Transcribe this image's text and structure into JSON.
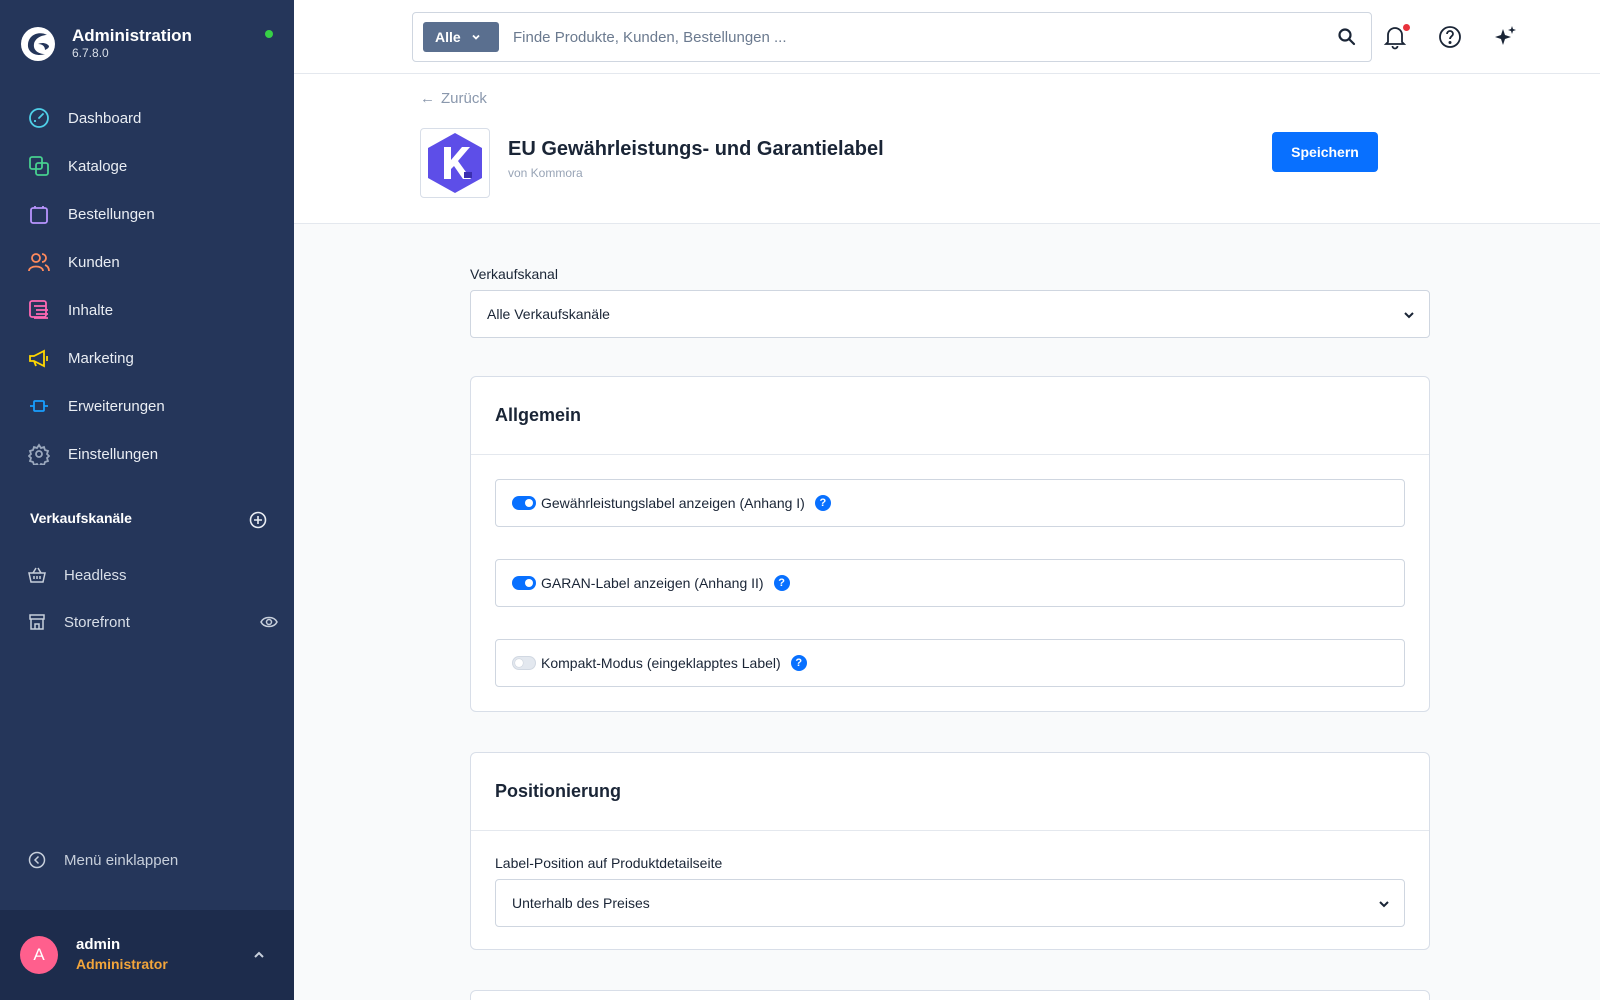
{
  "app": {
    "title": "Administration",
    "version": "6.7.8.0",
    "status_color": "#37d046",
    "accent_color": "#0870ff",
    "sidebar_color": "#25365a"
  },
  "sidebar": {
    "items": [
      {
        "label": "Dashboard",
        "icon": "dashboard-gauge-icon",
        "color": "#4fd0e8"
      },
      {
        "label": "Kataloge",
        "icon": "catalog-icon",
        "color": "#47d08f"
      },
      {
        "label": "Bestellungen",
        "icon": "shopping-bag-icon",
        "color": "#b995ff"
      },
      {
        "label": "Kunden",
        "icon": "users-icon",
        "color": "#ff8a5c"
      },
      {
        "label": "Inhalte",
        "icon": "content-icon",
        "color": "#ff68b4"
      },
      {
        "label": "Marketing",
        "icon": "megaphone-icon",
        "color": "#ffd700"
      },
      {
        "label": "Erweiterungen",
        "icon": "plugin-icon",
        "color": "#189eff"
      },
      {
        "label": "Einstellungen",
        "icon": "gear-icon",
        "color": "#9aa8bd"
      }
    ],
    "sales_channels_title": "Verkaufskanäle",
    "sales_channels": [
      {
        "label": "Headless",
        "icon": "basket-icon"
      },
      {
        "label": "Storefront",
        "icon": "storefront-icon"
      }
    ],
    "collapse_label": "Menü einklappen"
  },
  "user": {
    "initial": "A",
    "name": "admin",
    "role": "Administrator",
    "avatar_color": "#ff5f8d"
  },
  "search": {
    "type_label": "Alle",
    "placeholder": "Finde Produkte, Kunden, Bestellungen ..."
  },
  "header_icons": [
    "bell-icon",
    "help-circle-icon",
    "sparkles-icon"
  ],
  "page": {
    "back_label": "Zurück",
    "app_name": "EU Gewährleistungs- und Garantielabel",
    "vendor": "von Kommora",
    "save_label": "Speichern"
  },
  "sales_channel_field": {
    "label": "Verkaufskanal",
    "value": "Alle Verkaufskanäle"
  },
  "general": {
    "title": "Allgemein",
    "toggles": [
      {
        "label": "Gewährleistungslabel anzeigen (Anhang I)",
        "checked": true
      },
      {
        "label": "GARAN-Label anzeigen (Anhang II)",
        "checked": true
      },
      {
        "label": "Kompakt-Modus (eingeklapptes Label)",
        "checked": false
      }
    ]
  },
  "positioning": {
    "title": "Positionierung",
    "field_label": "Label-Position auf Produktdetailseite",
    "value": "Unterhalb des Preises"
  }
}
